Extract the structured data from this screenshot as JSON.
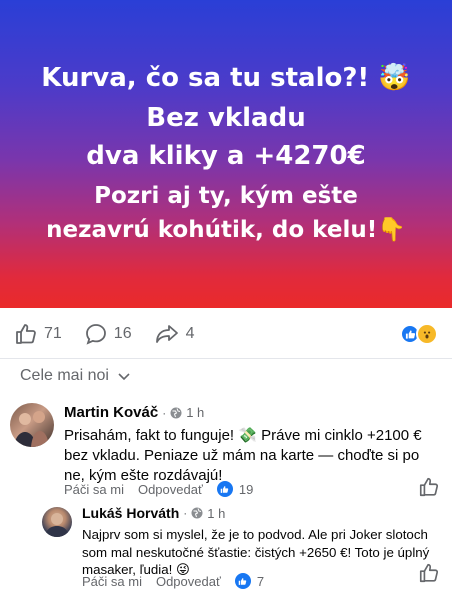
{
  "banner": {
    "line1": "Kurva, čo sa tu stalo?!",
    "line1_emoji": "🤯",
    "line2": "Bez vkladu",
    "line3": "dva kliky a +4270€",
    "line4": "Pozri aj ty, kým ešte",
    "line5": "nezavrú kohútik, do kelu!",
    "line5_emoji": "👇",
    "gradient_top": "#2a3fd6",
    "gradient_bottom": "#ea2a2a"
  },
  "reactions": {
    "like_count": "71",
    "comment_count": "16",
    "share_count": "4",
    "like_icon": "thumbs-up-icon",
    "comment_icon": "speech-bubble-icon",
    "share_icon": "share-arrow-icon"
  },
  "sort": {
    "label": "Cele mai noi"
  },
  "comments": [
    {
      "name": "Martin Kováč",
      "time": "1 h",
      "text": "Prisahám, fakt to funguje! 💸 Práve mi cinklo +2100 € bez vkladu. Peniaze už mám na karte — choďte si po ne, kým ešte rozdávajú!",
      "like_label": "Páči sa mi",
      "reply_label": "Odpovedať",
      "reaction_count": "19"
    },
    {
      "name": "Lukáš Horváth",
      "time": "1 h",
      "text": "Najprv som si myslel, že je to podvod. Ale pri Joker slotoch som mal neskutočné šťastie: čistých +2650 €! Toto je úplný masaker, ľudia! 😜",
      "like_label": "Páči sa mi",
      "reply_label": "Odpovedať",
      "reaction_count": "7"
    }
  ],
  "colors": {
    "accent": "#1877f2",
    "muted_text": "#65676b"
  }
}
